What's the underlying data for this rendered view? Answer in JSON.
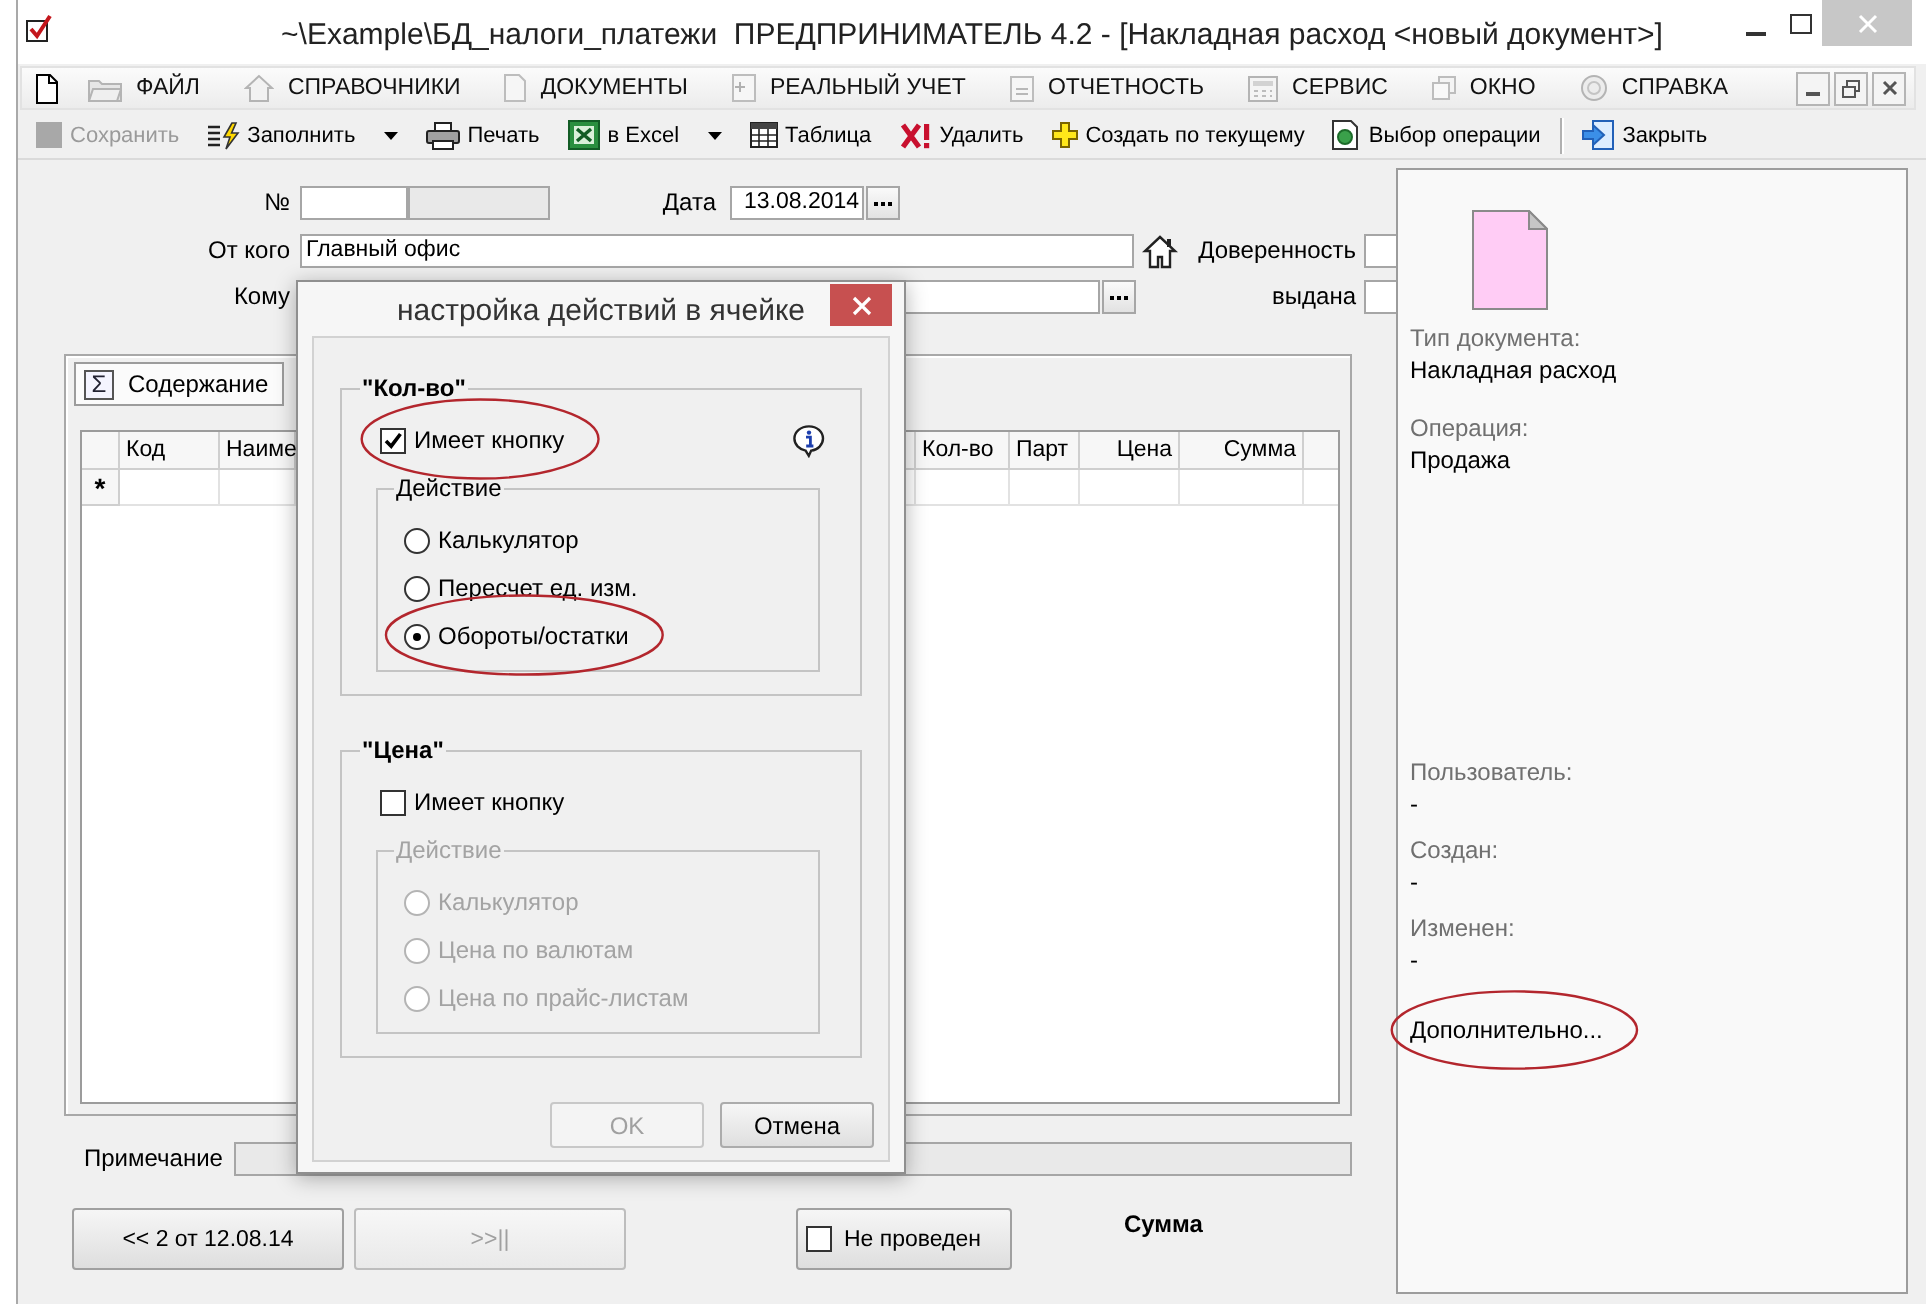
{
  "window": {
    "title": "~\\Example\\БД_налоги_платежи  ПРЕДПРИНИМАТЕЛЬ 4.2 - [Накладная расход <новый документ>]"
  },
  "menu": [
    {
      "label": "ФАЙЛ"
    },
    {
      "label": "СПРАВОЧНИКИ"
    },
    {
      "label": "ДОКУМЕНТЫ"
    },
    {
      "label": "РЕАЛЬНЫЙ УЧЕТ"
    },
    {
      "label": "ОТЧЕТНОСТЬ"
    },
    {
      "label": "СЕРВИС"
    },
    {
      "label": "ОКНО"
    },
    {
      "label": "СПРАВКА"
    }
  ],
  "toolbar": [
    {
      "kind": "button",
      "label": "Сохранить",
      "disabled": true,
      "dropdown": false
    },
    {
      "kind": "button",
      "label": "Заполнить",
      "disabled": false,
      "dropdown": true
    },
    {
      "kind": "button",
      "label": "Печать",
      "disabled": false,
      "dropdown": false
    },
    {
      "kind": "button",
      "label": "в Excel",
      "disabled": false,
      "dropdown": true
    },
    {
      "kind": "button",
      "label": "Таблица",
      "disabled": false,
      "dropdown": false
    },
    {
      "kind": "button",
      "label": "Удалить",
      "disabled": false,
      "dropdown": false
    },
    {
      "kind": "button",
      "label": "Создать по текущему",
      "disabled": false,
      "dropdown": false
    },
    {
      "kind": "button",
      "label": "Выбор операции",
      "disabled": false,
      "dropdown": false
    },
    {
      "kind": "separator"
    },
    {
      "kind": "button",
      "label": "Закрыть",
      "disabled": false,
      "dropdown": false
    }
  ],
  "form": {
    "number": {
      "label": "№"
    },
    "date": {
      "label": "Дата",
      "value": "13.08.2014"
    },
    "sender": {
      "label": "От кого",
      "value": "Главный офис"
    },
    "recipient": {
      "label": "Кому"
    },
    "attorney": {
      "label": "Доверенность"
    },
    "issued": {
      "label": "выдана"
    },
    "tabs": [
      {
        "symbol": "Σ",
        "label": "Содержание",
        "selected": true
      }
    ],
    "table": {
      "columns": [
        "Код",
        "Наиме",
        "Кол-во",
        "Парт",
        "Цена",
        "Сумма"
      ],
      "new_row_marker": "*"
    },
    "note": {
      "label": "Примечание"
    },
    "nav_buttons": [
      {
        "label": "<< 2 от 12.08.14",
        "disabled": false
      },
      {
        "label": ">>||",
        "disabled": true
      }
    ],
    "posted": {
      "label": "Не проведен",
      "checked": false
    },
    "total": {
      "label": "Сумма"
    }
  },
  "info_panel": {
    "fields": [
      {
        "label": "Тип документа:",
        "value": "Накладная расход"
      },
      {
        "label": "Операция:",
        "value": "Продажа"
      }
    ],
    "audit": [
      {
        "label": "Пользователь:",
        "value": "-"
      },
      {
        "label": "Создан:",
        "value": "-"
      },
      {
        "label": "Изменен:",
        "value": "-"
      }
    ],
    "more_link": {
      "label": "Дополнительно...",
      "circled": true
    }
  },
  "dialog": {
    "title": "настройка действий в ячейке",
    "groups": [
      {
        "title": "\"Кол-во\"",
        "has_button": {
          "label": "Имеет кнопку",
          "checked": true,
          "circled": true
        },
        "info_icon": true,
        "action": {
          "title": "Действие",
          "disabled": false,
          "options": [
            {
              "label": "Калькулятор",
              "selected": false,
              "circled": false
            },
            {
              "label": "Пересчет ед. изм.",
              "selected": false,
              "circled": false
            },
            {
              "label": "Обороты/остатки",
              "selected": true,
              "circled": true
            }
          ]
        }
      },
      {
        "title": "\"Цена\"",
        "has_button": {
          "label": "Имеет кнопку",
          "checked": false,
          "circled": false
        },
        "info_icon": false,
        "action": {
          "title": "Действие",
          "disabled": true,
          "options": [
            {
              "label": "Калькулятор",
              "selected": false,
              "circled": false
            },
            {
              "label": "Цена по валютам",
              "selected": false,
              "circled": false
            },
            {
              "label": "Цена по прайс-листам",
              "selected": false,
              "circled": false
            }
          ]
        }
      }
    ],
    "buttons": [
      {
        "label": "OK",
        "disabled": true
      },
      {
        "label": "Отмена",
        "disabled": false
      }
    ]
  }
}
